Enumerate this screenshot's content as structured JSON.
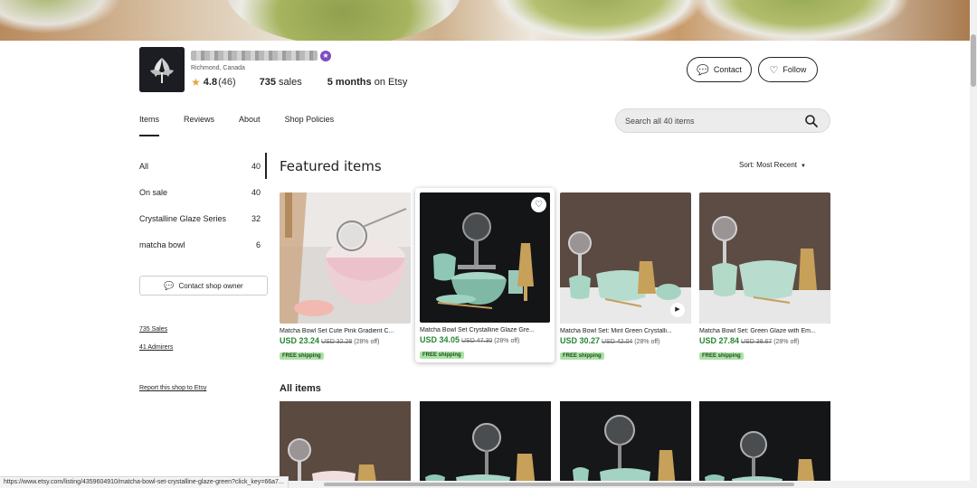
{
  "shop": {
    "location": "Richmond, Canada",
    "rating": "4.8",
    "rating_count": "(46)",
    "sales_count": "735",
    "sales_label": "sales",
    "months": "5 months",
    "months_suffix": "on Etsy"
  },
  "actions": {
    "contact": "Contact",
    "follow": "Follow"
  },
  "tabs": [
    {
      "label": "Items",
      "active": true
    },
    {
      "label": "Reviews"
    },
    {
      "label": "About"
    },
    {
      "label": "Shop Policies"
    }
  ],
  "search": {
    "placeholder": "Search all 40 items"
  },
  "sidebar": {
    "categories": [
      {
        "label": "All",
        "count": "40"
      },
      {
        "label": "On sale",
        "count": "40"
      },
      {
        "label": "Crystalline Glaze Series",
        "count": "32"
      },
      {
        "label": "matcha bowl",
        "count": "6"
      }
    ],
    "contact_owner": "Contact shop owner",
    "sales_link": "735 Sales",
    "admirers_link": "41 Admirers",
    "report_link": "Report this shop to Etsy"
  },
  "featured": {
    "title": "Featured items",
    "sort": "Sort: Most Recent",
    "items": [
      {
        "title": "Matcha Bowl Set Cute Pink Gradient C...",
        "price": "USD 23.24",
        "old_price": "USD 32.28",
        "discount": "(28% off)",
        "shipping": "FREE shipping"
      },
      {
        "title": "Matcha Bowl Set Crystalline Glaze Gre...",
        "price": "USD 34.05",
        "old_price": "USD 47.30",
        "discount": "(28% off)",
        "shipping": "FREE shipping"
      },
      {
        "title": "Matcha Bowl Set: Mint Green Crystalli...",
        "price": "USD 30.27",
        "old_price": "USD 42.04",
        "discount": "(28% off)",
        "shipping": "FREE shipping"
      },
      {
        "title": "Matcha Bowl Set: Green Glaze with Em...",
        "price": "USD 27.84",
        "old_price": "USD 38.67",
        "discount": "(28% off)",
        "shipping": "FREE shipping"
      }
    ]
  },
  "all_items": {
    "title": "All items"
  },
  "status_url": "https://www.etsy.com/listing/4359604910/matcha-bowl-set-crystalline-glaze-green?click_key=66a7..."
}
